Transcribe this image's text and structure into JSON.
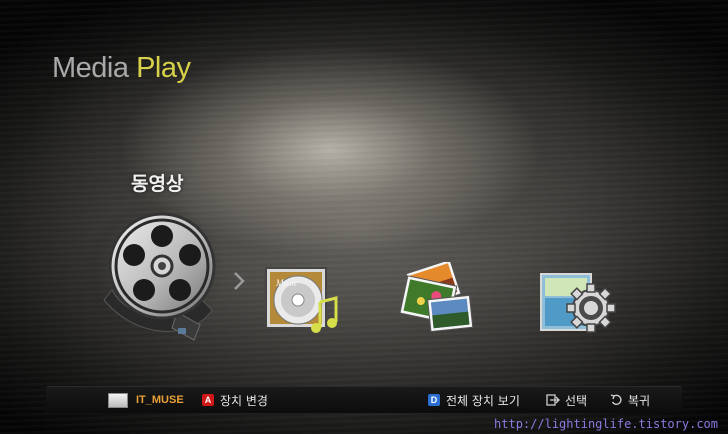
{
  "header": {
    "title_word1": "Media",
    "title_word2": "Play"
  },
  "selected_category": {
    "label": "동영상"
  },
  "categories": [
    {
      "id": "video",
      "icon": "film-reel-icon"
    },
    {
      "id": "music",
      "icon": "music-cd-icon"
    },
    {
      "id": "photos",
      "icon": "photos-icon"
    },
    {
      "id": "settings",
      "icon": "settings-gear-icon"
    }
  ],
  "bottom_bar": {
    "device_name": "IT_MUSE",
    "change_device_key": "A",
    "change_device_label": "장치 변경",
    "view_all_key": "D",
    "view_all_label": "전체 장치 보기",
    "select_label": "선택",
    "back_label": "복귀"
  },
  "watermark": "http://lightinglife.tistory.com",
  "colors": {
    "title_accent": "#d8d24a",
    "device_name": "#e9a038",
    "key_red": "#d01818",
    "key_blue": "#2a6fd0"
  }
}
